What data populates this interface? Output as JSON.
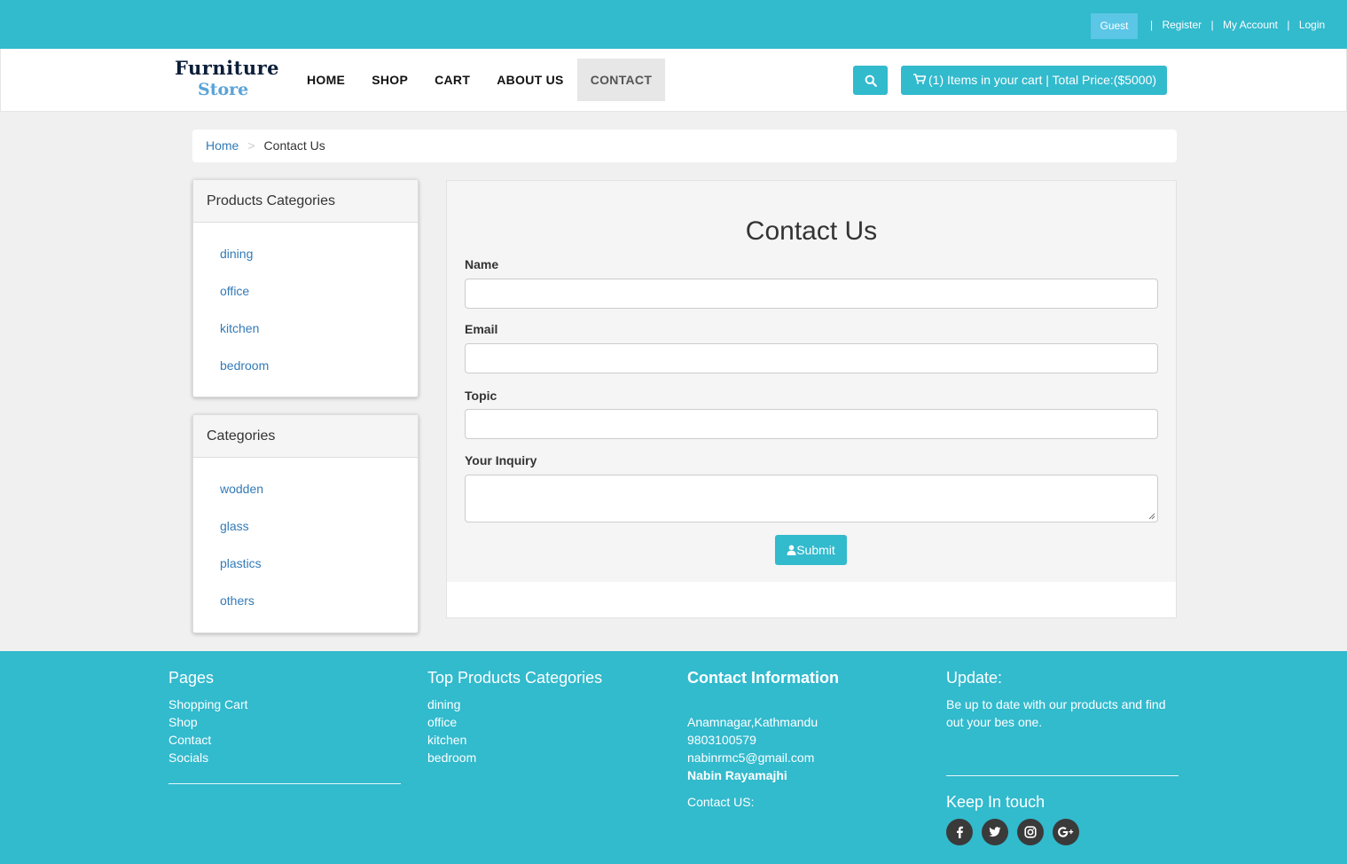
{
  "topbar": {
    "guest": "Guest",
    "links": [
      "Register",
      "My Account",
      "Login"
    ],
    "separator": "|"
  },
  "header": {
    "logo_line1": "Furniture",
    "logo_line2": "Store",
    "nav": [
      "HOME",
      "SHOP",
      "CART",
      "ABOUT US",
      "CONTACT"
    ],
    "active_nav": "CONTACT",
    "cart_label": "(1) Items in your cart | Total Price:($5000)"
  },
  "breadcrumb": {
    "home": "Home",
    "separator": ">",
    "current": "Contact Us"
  },
  "sidebar": {
    "products_categories": {
      "title": "Products Categories",
      "items": [
        "dining",
        "office",
        "kitchen",
        "bedroom"
      ]
    },
    "categories": {
      "title": "Categories",
      "items": [
        "wodden",
        "glass",
        "plastics",
        "others"
      ]
    }
  },
  "form": {
    "title": "Contact Us",
    "name_label": "Name",
    "email_label": "Email",
    "topic_label": "Topic",
    "inquiry_label": "Your Inquiry",
    "submit_label": "Submit"
  },
  "footer": {
    "pages": {
      "title": "Pages",
      "items": [
        "Shopping Cart",
        "Shop",
        "Contact",
        "Socials"
      ]
    },
    "top_categories": {
      "title": "Top Products Categories",
      "items": [
        "dining",
        "office",
        "kitchen",
        "bedroom"
      ]
    },
    "contact_info": {
      "title": "Contact Information",
      "address": "Anamnagar,Kathmandu",
      "phone": "9803100579",
      "email": "nabinrmc5@gmail.com",
      "name": "Nabin Rayamajhi",
      "contact_us": "Contact US:"
    },
    "update": {
      "title": "Update:",
      "text": "Be up to date with our products and find out your bes one.",
      "keep_in_touch": "Keep In touch",
      "socials": [
        "facebook-icon",
        "twitter-icon",
        "instagram-icon",
        "google-plus-icon"
      ]
    }
  },
  "colors": {
    "accent": "#32bacd",
    "link": "#337ab7"
  }
}
